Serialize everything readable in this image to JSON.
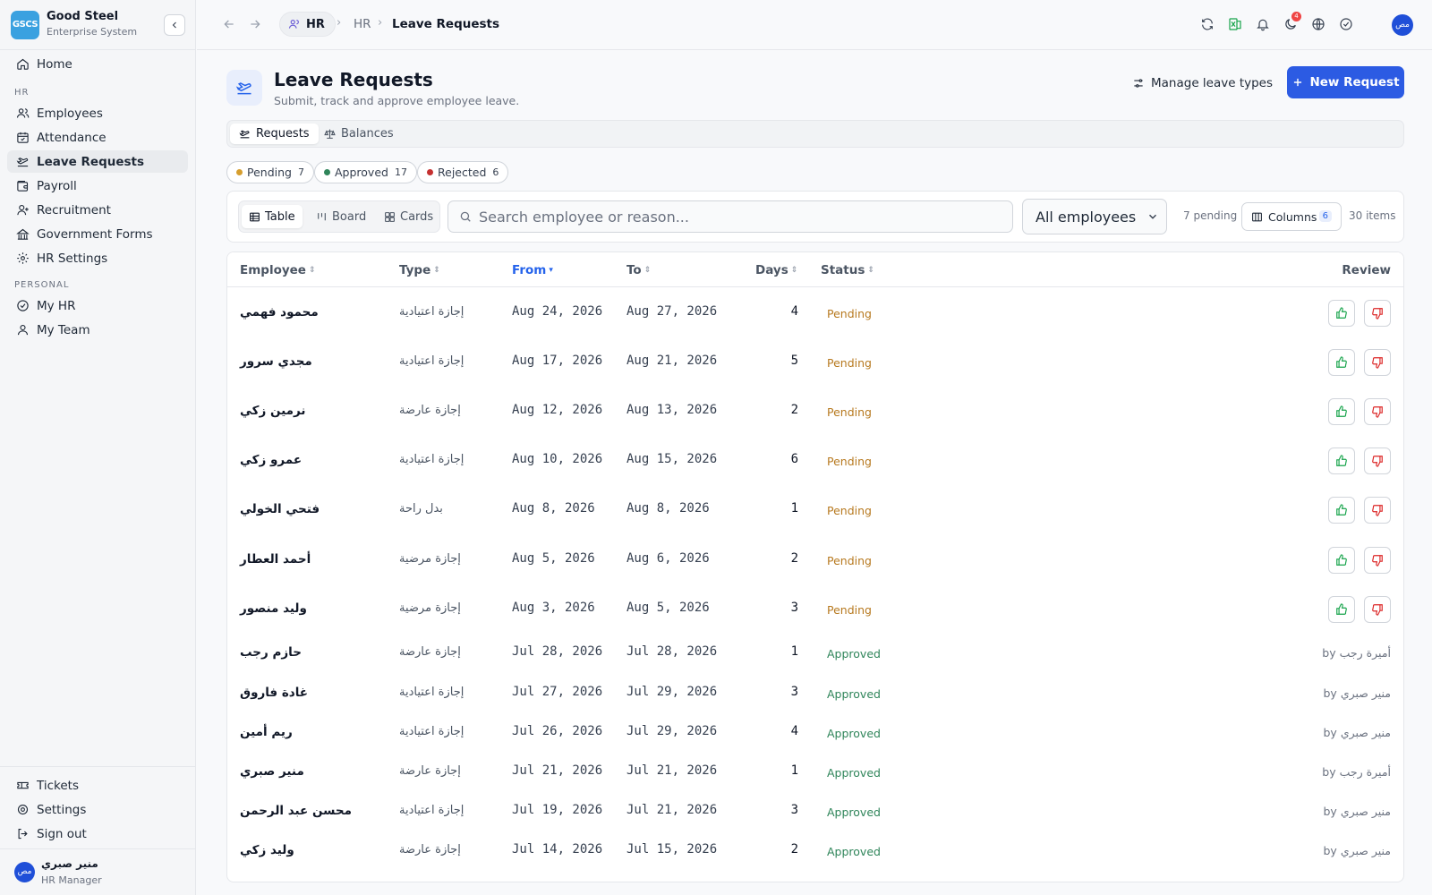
{
  "brand": {
    "logo": "GSCS",
    "name": "Good Steel",
    "subtitle": "Enterprise System"
  },
  "sidebar": {
    "top": [
      {
        "label": "Home",
        "icon": "home-icon"
      }
    ],
    "hr_section": "HR",
    "hr_items": [
      {
        "label": "Employees",
        "icon": "users-icon"
      },
      {
        "label": "Attendance",
        "icon": "calendar-check-icon"
      },
      {
        "label": "Leave Requests",
        "icon": "plane-departure-icon",
        "active": true
      },
      {
        "label": "Payroll",
        "icon": "wallet-icon"
      },
      {
        "label": "Recruitment",
        "icon": "user-plus-icon"
      },
      {
        "label": "Government Forms",
        "icon": "landmark-icon"
      },
      {
        "label": "HR Settings",
        "icon": "gear-icon"
      }
    ],
    "personal_section": "PERSONAL",
    "personal_items": [
      {
        "label": "My HR",
        "icon": "check-circle-icon"
      },
      {
        "label": "My Team",
        "icon": "user-icon"
      }
    ],
    "bottom_items": [
      {
        "label": "Tickets",
        "icon": "ticket-icon"
      },
      {
        "label": "Settings",
        "icon": "settings-icon"
      },
      {
        "label": "Sign out",
        "icon": "sign-out-icon"
      }
    ],
    "user": {
      "initials": "مص",
      "name": "منير صبري",
      "role": "HR Manager"
    }
  },
  "topbar": {
    "breadcrumb": [
      "HR",
      "HR",
      "Leave Requests"
    ],
    "notification_count": "4",
    "avatar_initials": "مص"
  },
  "page": {
    "title": "Leave Requests",
    "subtitle": "Submit, track and approve employee leave.",
    "manage_label": "Manage leave types",
    "new_label": "New Request"
  },
  "tabs": [
    {
      "label": "Requests",
      "active": true
    },
    {
      "label": "Balances",
      "active": false
    }
  ],
  "filters": [
    {
      "label": "Pending",
      "count": "7",
      "color": "#d69e2e"
    },
    {
      "label": "Approved",
      "count": "17",
      "color": "#2f855a"
    },
    {
      "label": "Rejected",
      "count": "6",
      "color": "#c53030"
    }
  ],
  "toolbar": {
    "views": [
      {
        "label": "Table",
        "active": true
      },
      {
        "label": "Board"
      },
      {
        "label": "Cards"
      }
    ],
    "search_placeholder": "Search employee or reason...",
    "employee_filter": "All employees",
    "pending_text": "7 pending",
    "columns_label": "Columns",
    "columns_count": "6",
    "items_text": "30 items"
  },
  "table": {
    "headers": {
      "employee": "Employee",
      "type": "Type",
      "from": "From",
      "to": "To",
      "days": "Days",
      "status": "Status",
      "review": "Review"
    },
    "rows": [
      {
        "employee": "محمود فهمي",
        "type": "إجازة اعتيادية",
        "from": "Aug 24, 2026",
        "to": "Aug 27, 2026",
        "days": "4",
        "status": "Pending"
      },
      {
        "employee": "مجدي سرور",
        "type": "إجازة اعتيادية",
        "from": "Aug 17, 2026",
        "to": "Aug 21, 2026",
        "days": "5",
        "status": "Pending"
      },
      {
        "employee": "نرمين زكي",
        "type": "إجازة عارضة",
        "from": "Aug 12, 2026",
        "to": "Aug 13, 2026",
        "days": "2",
        "status": "Pending"
      },
      {
        "employee": "عمرو زكي",
        "type": "إجازة اعتيادية",
        "from": "Aug 10, 2026",
        "to": "Aug 15, 2026",
        "days": "6",
        "status": "Pending"
      },
      {
        "employee": "فتحي الخولي",
        "type": "بدل راحة",
        "from": "Aug 8, 2026",
        "to": "Aug 8, 2026",
        "days": "1",
        "status": "Pending"
      },
      {
        "employee": "أحمد العطار",
        "type": "إجازة مرضية",
        "from": "Aug 5, 2026",
        "to": "Aug 6, 2026",
        "days": "2",
        "status": "Pending"
      },
      {
        "employee": "وليد منصور",
        "type": "إجازة مرضية",
        "from": "Aug 3, 2026",
        "to": "Aug 5, 2026",
        "days": "3",
        "status": "Pending"
      },
      {
        "employee": "حازم رجب",
        "type": "إجازة عارضة",
        "from": "Jul 28, 2026",
        "to": "Jul 28, 2026",
        "days": "1",
        "status": "Approved",
        "reviewer": "by أميرة رجب"
      },
      {
        "employee": "غادة فاروق",
        "type": "إجازة اعتيادية",
        "from": "Jul 27, 2026",
        "to": "Jul 29, 2026",
        "days": "3",
        "status": "Approved",
        "reviewer": "by منير صبري"
      },
      {
        "employee": "ريم أمين",
        "type": "إجازة اعتيادية",
        "from": "Jul 26, 2026",
        "to": "Jul 29, 2026",
        "days": "4",
        "status": "Approved",
        "reviewer": "by منير صبري"
      },
      {
        "employee": "منير صبري",
        "type": "إجازة عارضة",
        "from": "Jul 21, 2026",
        "to": "Jul 21, 2026",
        "days": "1",
        "status": "Approved",
        "reviewer": "by أميرة رجب"
      },
      {
        "employee": "محسن عبد الرحمن",
        "type": "إجازة اعتيادية",
        "from": "Jul 19, 2026",
        "to": "Jul 21, 2026",
        "days": "3",
        "status": "Approved",
        "reviewer": "by منير صبري"
      },
      {
        "employee": "وليد زكي",
        "type": "إجازة عارضة",
        "from": "Jul 14, 2026",
        "to": "Jul 15, 2026",
        "days": "2",
        "status": "Approved",
        "reviewer": "by منير صبري"
      }
    ]
  }
}
